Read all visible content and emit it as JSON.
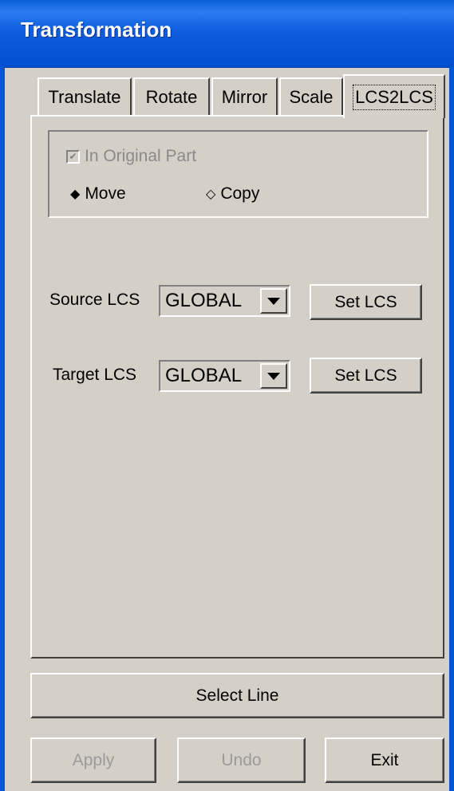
{
  "window": {
    "title": "Transformation"
  },
  "tabs": [
    {
      "label": "Translate",
      "active": false
    },
    {
      "label": "Rotate",
      "active": false
    },
    {
      "label": "Mirror",
      "active": false
    },
    {
      "label": "Scale",
      "active": false
    },
    {
      "label": "LCS2LCS",
      "active": true
    }
  ],
  "options": {
    "in_original_part": {
      "label": "In Original Part",
      "checked": true,
      "enabled": false
    },
    "move": {
      "label": "Move",
      "selected": true
    },
    "copy": {
      "label": "Copy",
      "selected": false
    }
  },
  "source": {
    "label": "Source LCS",
    "value": "GLOBAL",
    "button": "Set LCS"
  },
  "target": {
    "label": "Target LCS",
    "value": "GLOBAL",
    "button": "Set LCS"
  },
  "select_line": "Select Line",
  "footer": {
    "apply": {
      "label": "Apply",
      "enabled": false
    },
    "undo": {
      "label": "Undo",
      "enabled": false
    },
    "exit": {
      "label": "Exit",
      "enabled": true
    }
  },
  "colors": {
    "titlebar": "#0a5fd6",
    "face": "#d4d0c8"
  },
  "icons": {
    "check": "checkmark-icon",
    "radio_selected": "filled-diamond-icon",
    "radio_unselected": "hollow-diamond-icon"
  }
}
